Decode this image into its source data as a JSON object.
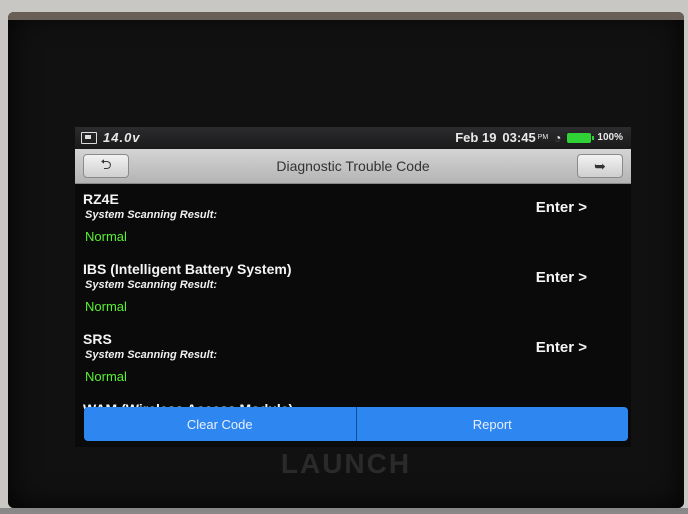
{
  "status": {
    "voltage": "14.0v",
    "date": "Feb 19",
    "time": "03:45",
    "ampm": "PM",
    "battery_pct": "100%",
    "battery_color": "#2fd336"
  },
  "titlebar": {
    "title": "Diagnostic Trouble Code",
    "back_icon": "back-arrow-icon",
    "exit_icon": "exit-icon"
  },
  "systems": [
    {
      "name": "RZ4E",
      "result_label": "System Scanning Result:",
      "result": "Normal",
      "action": "Enter >"
    },
    {
      "name": "IBS (Intelligent Battery System)",
      "result_label": "System Scanning Result:",
      "result": "Normal",
      "action": "Enter >"
    },
    {
      "name": "SRS",
      "result_label": "System Scanning Result:",
      "result": "Normal",
      "action": "Enter >"
    },
    {
      "name": "WAM (Wireless Access Module)"
    }
  ],
  "bottom": {
    "clear_label": "Clear Code",
    "report_label": "Report"
  },
  "brand": "LAUNCH",
  "colors": {
    "accent": "#2e86f0",
    "normal": "#5af032"
  }
}
